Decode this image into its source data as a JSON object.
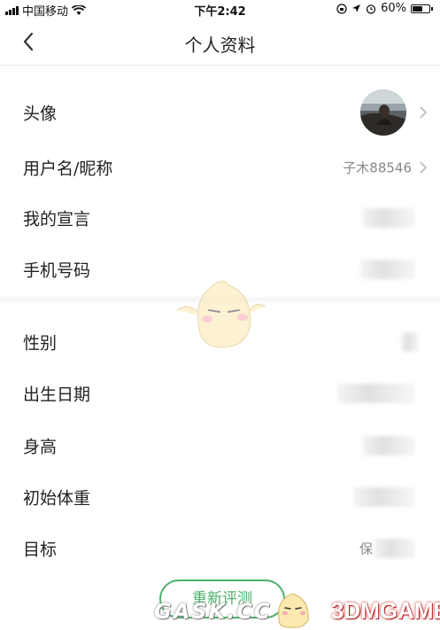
{
  "status_bar": {
    "carrier": "中国移动",
    "time": "下午2:42",
    "battery": "60%",
    "battery_level": 0.6
  },
  "nav": {
    "title": "个人资料",
    "back_icon": "chevron-left-icon"
  },
  "rows": [
    {
      "label": "头像",
      "value": ""
    },
    {
      "label": "用户名/昵称",
      "value": "子木88546"
    },
    {
      "label": "我的宣言",
      "value": ""
    },
    {
      "label": "手机号码",
      "value": ""
    },
    {
      "label": "性别",
      "value": ""
    },
    {
      "label": "出生日期",
      "value": ""
    },
    {
      "label": "身高",
      "value": ""
    },
    {
      "label": "初始体重",
      "value": ""
    },
    {
      "label": "目标",
      "value": "保"
    }
  ],
  "footer": {
    "reevaluate_label": "重新评测"
  },
  "watermark": {
    "left_text": "GASK.CC",
    "right_text": "3DMGAME"
  },
  "colors": {
    "accent_green": "#4caf6a",
    "divider": "#e8e8e8"
  }
}
